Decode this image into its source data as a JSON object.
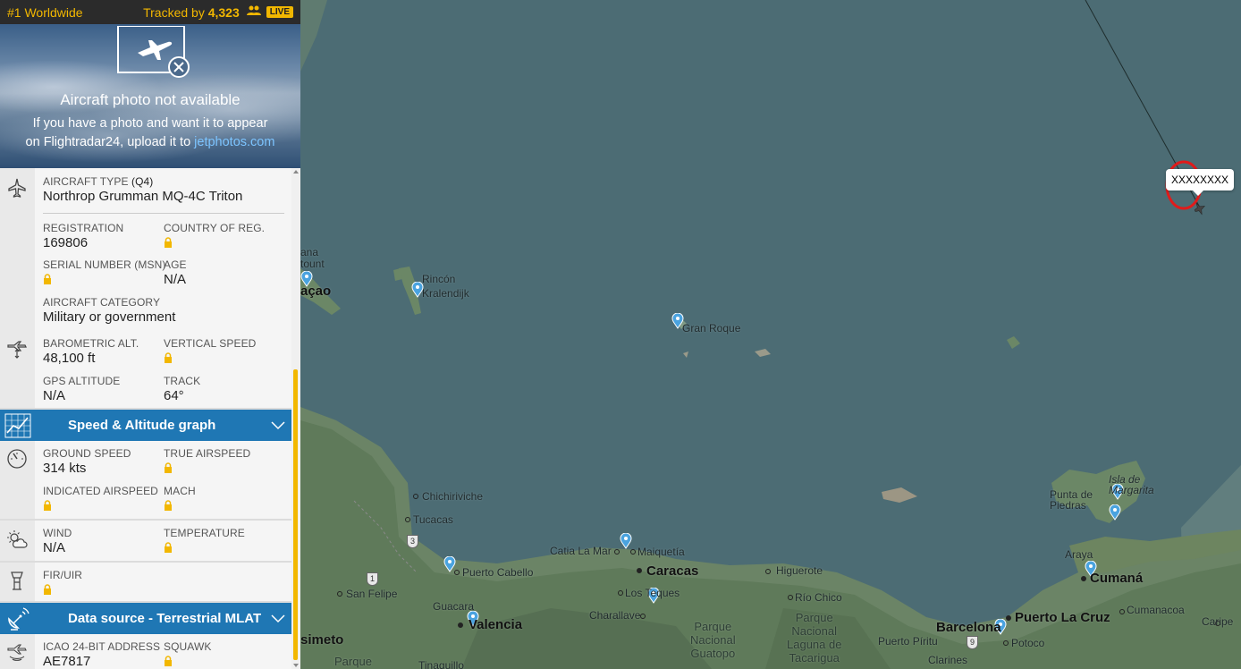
{
  "topbar": {
    "rank": "#1 Worldwide",
    "tracked_prefix": "Tracked by ",
    "tracked_count": "4,323",
    "live_badge": "LIVE"
  },
  "photo": {
    "title": "Aircraft photo not available",
    "line1": "If you have a photo and want it to appear",
    "line2_prefix": "on Flightradar24, upload it to ",
    "link": "jetphotos.com"
  },
  "aircraft": {
    "type_label": "AIRCRAFT TYPE",
    "type_code": "(Q4)",
    "type_value": "Northrop Grumman MQ-4C Triton",
    "registration_label": "REGISTRATION",
    "registration_value": "169806",
    "country_label": "COUNTRY OF REG.",
    "serial_label": "SERIAL NUMBER (MSN)",
    "age_label": "AGE",
    "age_value": "N/A",
    "category_label": "AIRCRAFT CATEGORY",
    "category_value": "Military or government"
  },
  "altitude": {
    "baro_label": "BAROMETRIC ALT.",
    "baro_value": "48,100 ft",
    "vs_label": "VERTICAL SPEED",
    "gps_label": "GPS ALTITUDE",
    "gps_value": "N/A",
    "track_label": "TRACK",
    "track_value": "64°"
  },
  "speed_graph": {
    "label": "Speed & Altitude graph"
  },
  "speed": {
    "gs_label": "GROUND SPEED",
    "gs_value": "314 kts",
    "tas_label": "TRUE AIRSPEED",
    "ias_label": "INDICATED AIRSPEED",
    "mach_label": "MACH"
  },
  "weather": {
    "wind_label": "WIND",
    "wind_value": "N/A",
    "temp_label": "TEMPERATURE"
  },
  "fir": {
    "label": "FIR/UIR"
  },
  "datasource": {
    "label": "Data source - Terrestrial MLAT"
  },
  "ident": {
    "icao_label": "ICAO 24-BIT ADDRESS",
    "icao_value": "AE7817",
    "squawk_label": "SQUAWK"
  },
  "map": {
    "callsign": "XXXXXXXX",
    "labels": {
      "rincon": "Rincón",
      "kralendijk": "Kralendijk",
      "curacao_partial": "açao",
      "ana_partial": "ana",
      "tount_partial": "tount",
      "gran_roque": "Gran Roque",
      "chichiriviche": "Chichiriviche",
      "tucacas": "Tucacas",
      "catia": "Catia La Mar",
      "maiquetia": "Maiquetía",
      "caracas": "Caracas",
      "higuerote": "Higuerote",
      "rio_chico": "Río Chico",
      "puerto_cabello": "Puerto Cabello",
      "san_felipe": "San Felipe",
      "los_teques": "Los Teques",
      "guacara": "Guacara",
      "valencia": "Valencia",
      "charallave": "Charallave",
      "park1": "Parque\nNacional\nGuatopo",
      "park2": "Parque\nNacional\nLaguna de\nTacarigua",
      "park3": "Parque",
      "simeto": "simeto",
      "tinaquillo": "Tinaquillo",
      "barcelona": "Barcelona",
      "puerto_la_cruz": "Puerto La Cruz",
      "puerto_piritu": "Puerto Píritu",
      "potoco": "Potoco",
      "clarines": "Clarines",
      "cumana": "Cumaná",
      "cumanacoa": "Cumanacoa",
      "araya": "Araya",
      "caripe": "Caripe",
      "punta_de_piedras": "Punta de\nPiedras",
      "isla_margarita": "Isla de\nMargarita"
    },
    "shields": [
      "3",
      "1",
      "9"
    ]
  },
  "colors": {
    "accent": "#f2b700",
    "blue_bar": "#1f77b4",
    "link": "#7cc4ff",
    "ocean": "#4c6c74"
  }
}
